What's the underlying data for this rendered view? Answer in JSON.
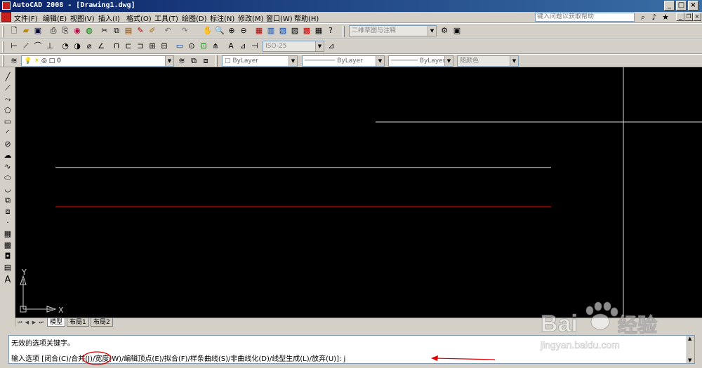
{
  "window": {
    "title": "AutoCAD 2008 - [Drawing1.dwg]"
  },
  "menu": {
    "items": [
      "文件(F)",
      "编辑(E)",
      "视图(V)",
      "插入(I)",
      "格式(O)",
      "工具(T)",
      "绘图(D)",
      "标注(N)",
      "修改(M)",
      "窗口(W)",
      "帮助(H)"
    ],
    "help_search_placeholder": "键入问题以获取帮助"
  },
  "toolbars": {
    "workspace": "二维草图与注释",
    "dim_style": "ISO-25",
    "layer": "0",
    "color": "ByLayer",
    "linetype": "ByLayer",
    "lineweight": "ByLayer",
    "plot_style": "随颜色"
  },
  "drawing": {
    "ucs_x": "X",
    "ucs_y": "Y",
    "line_colors": {
      "white": "#c8c8c8",
      "red": "#b00000"
    }
  },
  "tabs": {
    "model": "模型",
    "layout1": "布局1",
    "layout2": "布局2"
  },
  "command": {
    "history": "无效的选项关键字。",
    "prompt": "输入选项 [闭合(C)/合并(J)/宽度(W)/编辑顶点(E)/拟合(F)/样条曲线(S)/非曲线化(D)/线型生成(L)/放弃(U)]: j",
    "highlight_option": "合并(J)"
  },
  "watermark": {
    "brand": "Bai",
    "brand2": "经验",
    "url": "jingyan.baidu.com"
  }
}
